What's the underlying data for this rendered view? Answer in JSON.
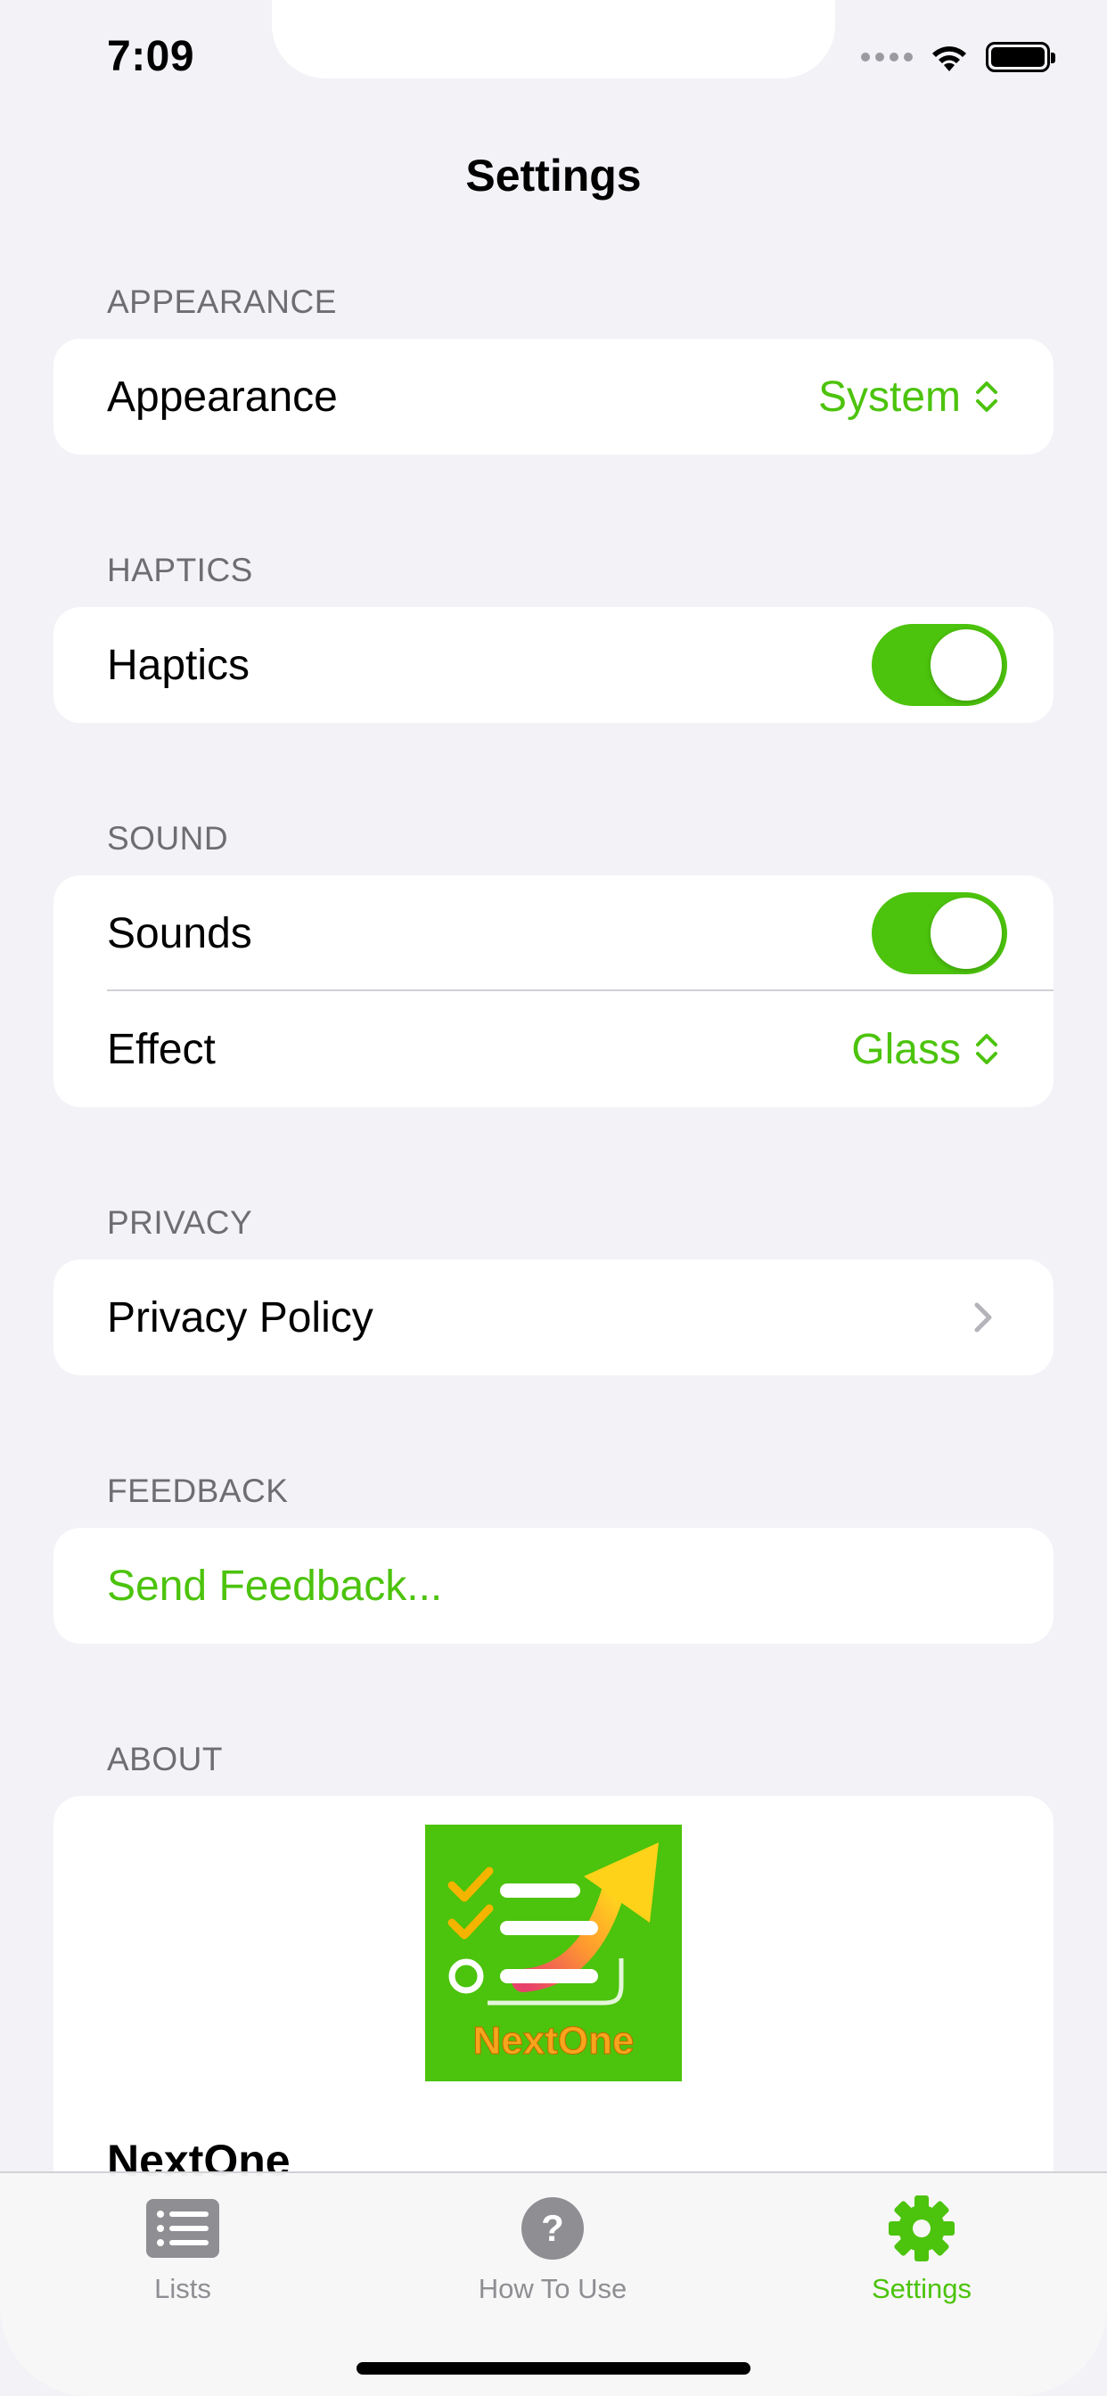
{
  "status": {
    "time": "7:09"
  },
  "nav": {
    "title": "Settings"
  },
  "sections": {
    "appearance": {
      "header": "APPEARANCE",
      "row_label": "Appearance",
      "value": "System"
    },
    "haptics": {
      "header": "HAPTICS",
      "row_label": "Haptics",
      "toggle_on": true
    },
    "sound": {
      "header": "SOUND",
      "sounds_label": "Sounds",
      "sounds_on": true,
      "effect_label": "Effect",
      "effect_value": "Glass"
    },
    "privacy": {
      "header": "PRIVACY",
      "row_label": "Privacy Policy"
    },
    "feedback": {
      "header": "FEEDBACK",
      "row_label": "Send Feedback..."
    },
    "about": {
      "header": "ABOUT",
      "logo_text": "NextOne",
      "app_name": "NextOne"
    }
  },
  "tabs": [
    {
      "label": "Lists",
      "icon": "list-icon",
      "active": false
    },
    {
      "label": "How To Use",
      "icon": "question-icon",
      "active": false
    },
    {
      "label": "Settings",
      "icon": "gear-icon",
      "active": true
    }
  ],
  "colors": {
    "accent": "#4cc30c",
    "background": "#f2f2f7",
    "secondary_text": "#6d6d72"
  }
}
